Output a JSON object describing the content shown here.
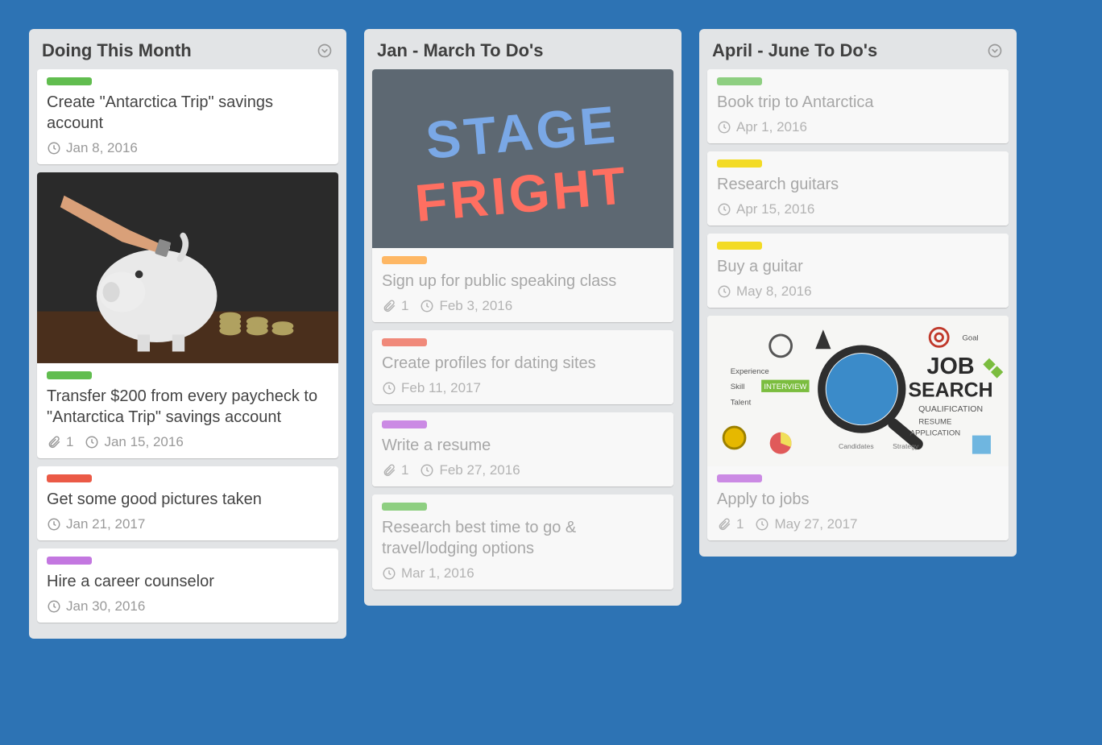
{
  "lists": [
    {
      "title": "Doing This Month",
      "menu": true,
      "dimmed": false,
      "cards": [
        {
          "label": "green",
          "title": "Create \"Antarctica Trip\" savings account",
          "due": "Jan 8, 2016",
          "attachments": null,
          "cover": null
        },
        {
          "label": "green",
          "title": "Transfer $200 from every paycheck to \"Antarctica Trip\" savings account",
          "due": "Jan 15, 2016",
          "attachments": "1",
          "cover": "piggy"
        },
        {
          "label": "red",
          "title": "Get some good pictures taken",
          "due": "Jan 21, 2017",
          "attachments": null,
          "cover": null
        },
        {
          "label": "purple",
          "title": "Hire a career counselor",
          "due": "Jan 30, 2016",
          "attachments": null,
          "cover": null
        }
      ]
    },
    {
      "title": "Jan - March To Do's",
      "menu": false,
      "dimmed": true,
      "cards": [
        {
          "label": "orange",
          "title": "Sign up for public speaking class",
          "due": "Feb 3, 2016",
          "attachments": "1",
          "cover": "stage"
        },
        {
          "label": "salmon",
          "title": "Create profiles for dating sites",
          "due": "Feb 11, 2017",
          "attachments": null,
          "cover": null
        },
        {
          "label": "purple",
          "title": "Write a resume",
          "due": "Feb 27, 2016",
          "attachments": "1",
          "cover": null
        },
        {
          "label": "lime",
          "title": "Research best time to go & travel/lodging options",
          "due": "Mar 1, 2016",
          "attachments": null,
          "cover": null
        }
      ]
    },
    {
      "title": "April - June To Do's",
      "menu": true,
      "dimmed": true,
      "cards": [
        {
          "label": "lime",
          "title": "Book trip to Antarctica",
          "due": "Apr 1, 2016",
          "attachments": null,
          "cover": null
        },
        {
          "label": "yellow",
          "title": "Research guitars",
          "due": "Apr 15, 2016",
          "attachments": null,
          "cover": null
        },
        {
          "label": "yellow",
          "title": "Buy a guitar",
          "due": "May 8, 2016",
          "attachments": null,
          "cover": null
        },
        {
          "label": "purple",
          "title": "Apply to jobs",
          "due": "May 27, 2017",
          "attachments": "1",
          "cover": "jobsearch"
        }
      ]
    }
  ]
}
